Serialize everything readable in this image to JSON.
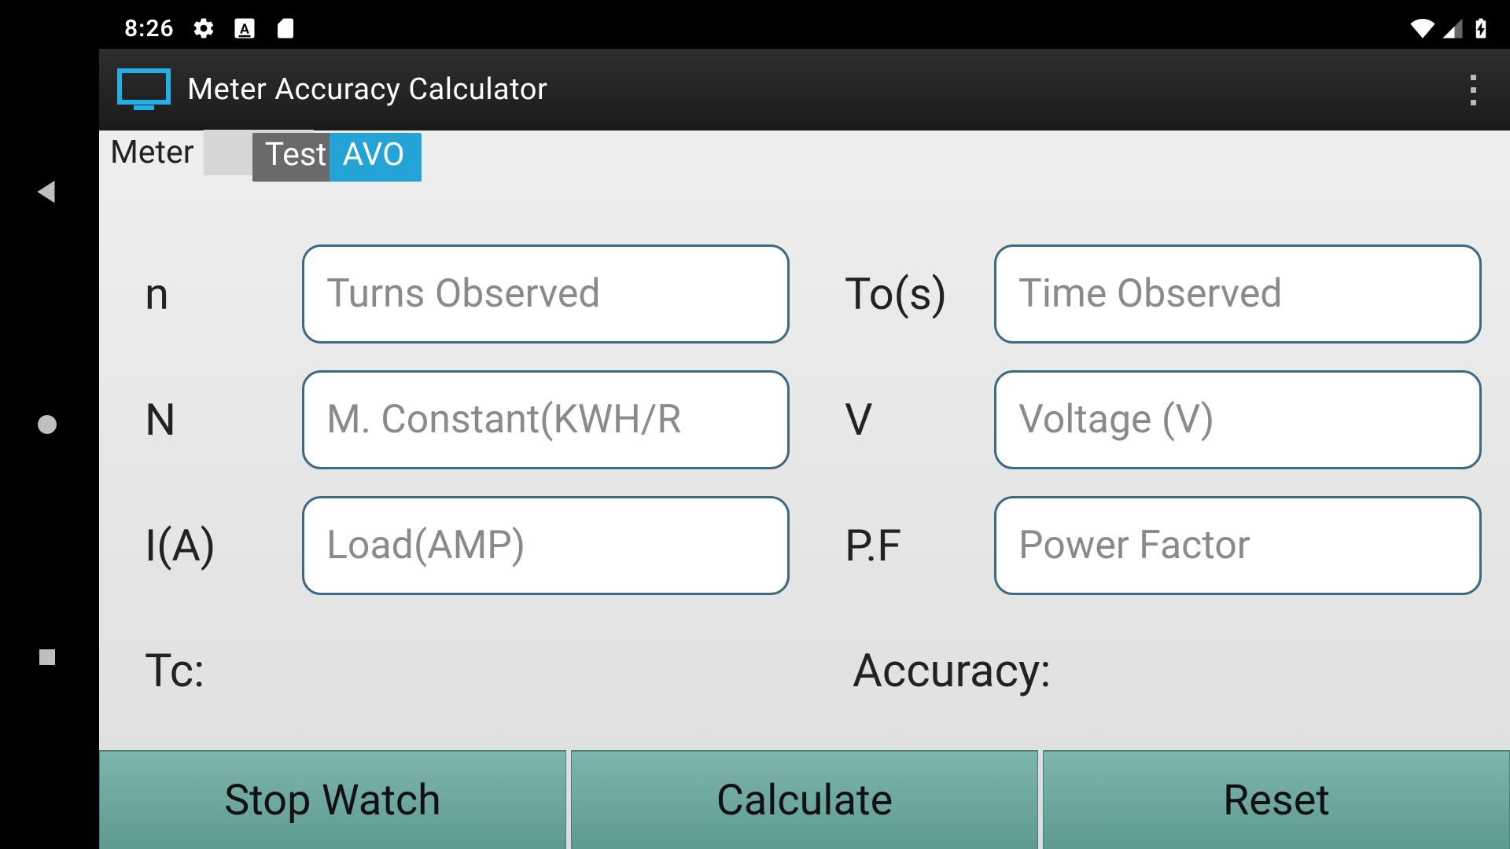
{
  "statusbar": {
    "time": "8:26"
  },
  "actionbar": {
    "title": "Meter Accuracy Calculator"
  },
  "tabs": {
    "meter": "Meter",
    "test": "Test",
    "avo": "AVO"
  },
  "labels": {
    "n": "n",
    "N": "N",
    "I": "I(A)",
    "To": "To(s)",
    "V": "V",
    "PF": "P.F",
    "Tc": "Tc:",
    "Accuracy": "Accuracy:"
  },
  "placeholders": {
    "n": "Turns Observed",
    "N": "M. Constant(KWH/R",
    "I": "Load(AMP)",
    "To": "Time Observed",
    "V": "Voltage (V)",
    "PF": "Power Factor"
  },
  "buttons": {
    "stopwatch": "Stop Watch",
    "calculate": "Calculate",
    "reset": "Reset"
  }
}
